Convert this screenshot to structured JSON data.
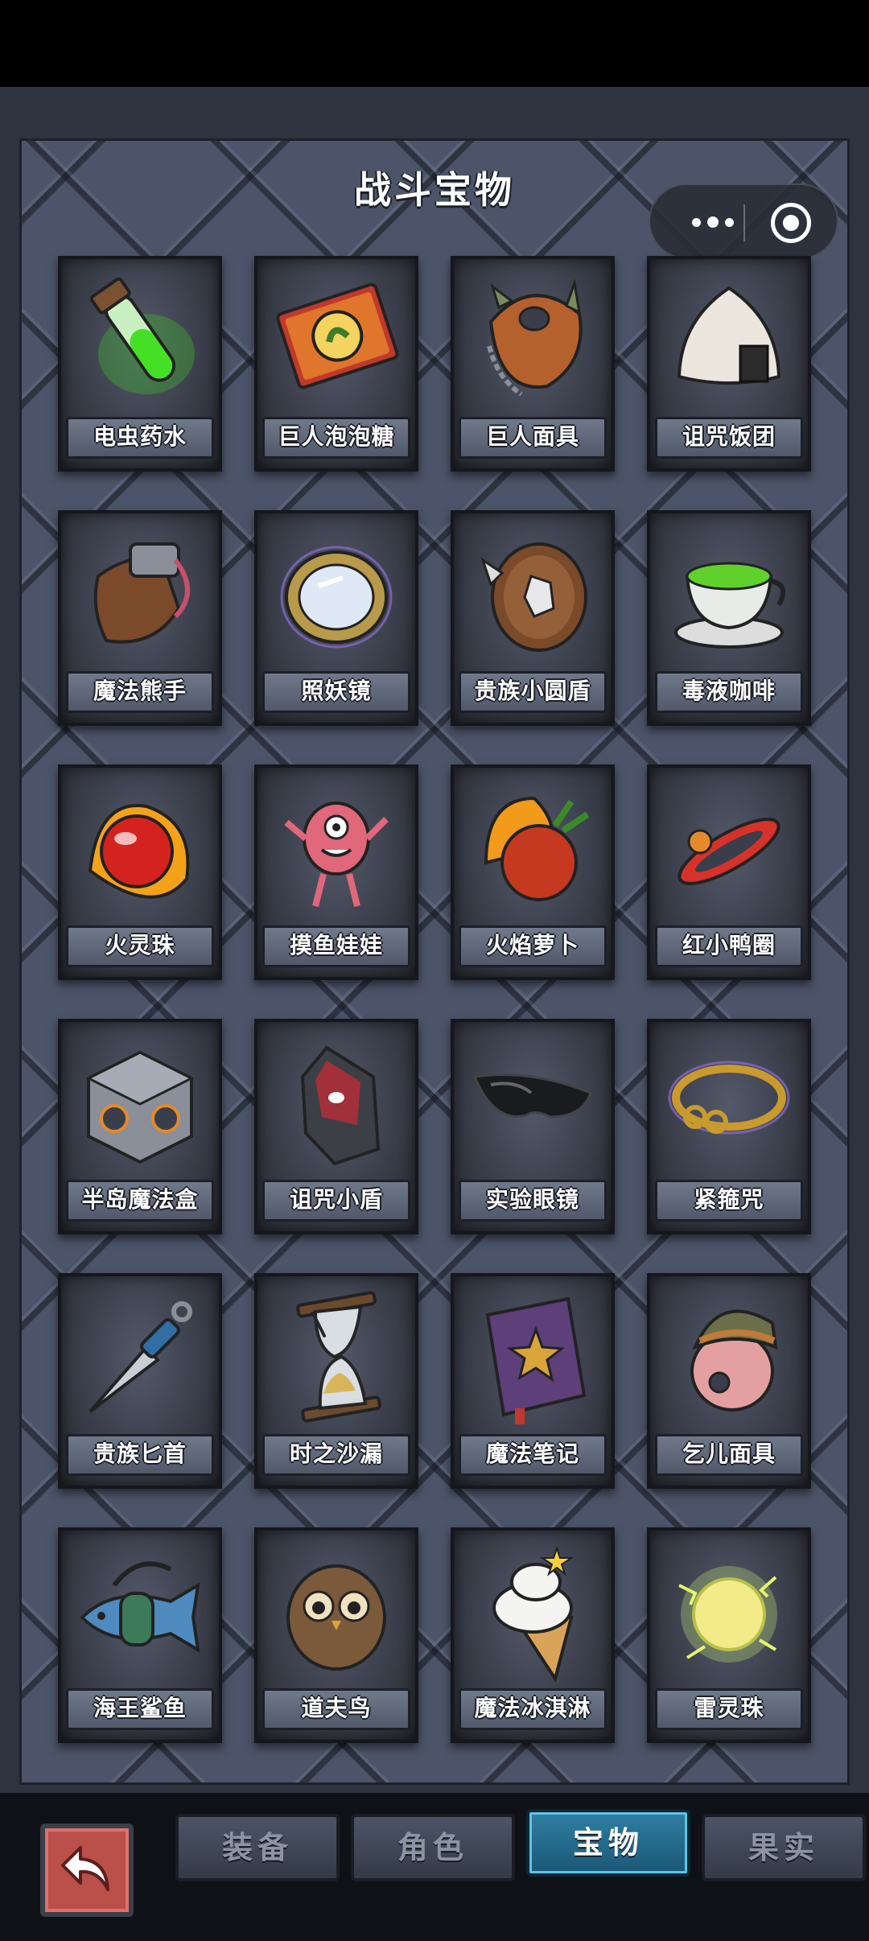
{
  "title": "战斗宝物",
  "capsule": {
    "more_icon": "more-dots-icon",
    "close_icon": "target-close-icon"
  },
  "items": [
    {
      "name": "电虫药水",
      "icon": "potion-tube-icon"
    },
    {
      "name": "巨人泡泡糖",
      "icon": "gum-pack-icon"
    },
    {
      "name": "巨人面具",
      "icon": "spiked-mask-icon"
    },
    {
      "name": "诅咒饭团",
      "icon": "rice-ball-icon"
    },
    {
      "name": "魔法熊手",
      "icon": "bear-paw-icon"
    },
    {
      "name": "照妖镜",
      "icon": "mirror-icon"
    },
    {
      "name": "贵族小圆盾",
      "icon": "round-shield-icon"
    },
    {
      "name": "毒液咖啡",
      "icon": "poison-cup-icon"
    },
    {
      "name": "火灵珠",
      "icon": "fire-orb-icon"
    },
    {
      "name": "摸鱼娃娃",
      "icon": "pink-doll-icon"
    },
    {
      "name": "火焰萝卜",
      "icon": "fire-radish-icon"
    },
    {
      "name": "红小鸭圈",
      "icon": "red-swim-ring-icon"
    },
    {
      "name": "半岛魔法盒",
      "icon": "magic-cube-icon"
    },
    {
      "name": "诅咒小盾",
      "icon": "cursed-shield-icon"
    },
    {
      "name": "实验眼镜",
      "icon": "goggles-icon"
    },
    {
      "name": "紧箍咒",
      "icon": "gold-band-icon"
    },
    {
      "name": "贵族匕首",
      "icon": "dagger-icon"
    },
    {
      "name": "时之沙漏",
      "icon": "hourglass-icon"
    },
    {
      "name": "魔法笔记",
      "icon": "spellbook-icon"
    },
    {
      "name": "乞儿面具",
      "icon": "beggar-mask-icon"
    },
    {
      "name": "海王鲨鱼",
      "icon": "shark-icon"
    },
    {
      "name": "道夫鸟",
      "icon": "owl-icon"
    },
    {
      "name": "魔法冰淇淋",
      "icon": "ice-cream-icon"
    },
    {
      "name": "雷灵珠",
      "icon": "thunder-orb-icon"
    }
  ],
  "tabs": [
    {
      "label": "装备"
    },
    {
      "label": "角色"
    },
    {
      "label": "宝物"
    },
    {
      "label": "果实"
    }
  ],
  "active_tab": "宝物",
  "back_icon": "back-arrow-icon",
  "colors": {
    "panel": "#4b5468",
    "active_tab": "#1f6c92",
    "back_button": "#bb4f4a"
  }
}
